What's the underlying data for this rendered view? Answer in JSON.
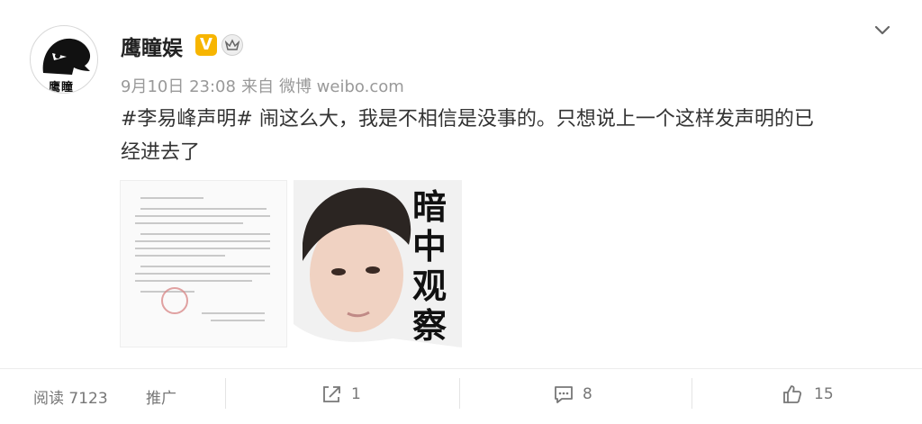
{
  "user": {
    "name": "鹰瞳娱",
    "avatar_text": "鹰瞳",
    "verified_badge": "V",
    "verified_color": "#f7b500"
  },
  "meta": {
    "date": "9月10日 23:08",
    "via_label": "来自",
    "source": "微博 weibo.com"
  },
  "post": {
    "hashtag": "#李易峰声明#",
    "line1_rest": " 闹这么大，我是不相信是没事的。只想说上一个这样发声明的已",
    "line2": "经进去了"
  },
  "images": {
    "overlay_chars": [
      "暗",
      "中",
      "观",
      "察"
    ]
  },
  "actions": {
    "reads_label": "阅读 7123",
    "promote_label": "推广",
    "repost_count": "1",
    "comment_count": "8",
    "like_count": "15"
  },
  "icons": {
    "menu": "chevron-down-icon",
    "repost": "share-icon",
    "comment": "comment-icon",
    "like": "thumbs-up-icon",
    "crown": "crown-icon"
  }
}
